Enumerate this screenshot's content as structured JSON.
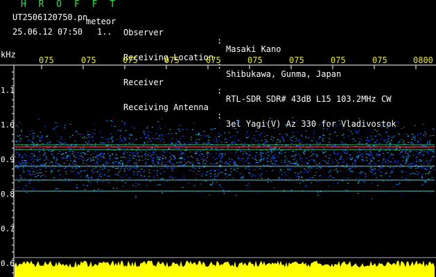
{
  "app": {
    "title": "H R O F F T"
  },
  "file": {
    "name": "UT2506120750.pn",
    "meteor_label": "meteor",
    "datetime": "25.06.12 07:50",
    "page": "1.."
  },
  "meta": [
    {
      "key": "Observer",
      "value": "Masaki Kano"
    },
    {
      "key": "Receiving Location",
      "value": "Shibukawa, Gunma, Japan"
    },
    {
      "key": "Receiver",
      "value": "RTL-SDR SDR# 43dB L15 103.2MHz CW"
    },
    {
      "key": "Receiving Antenna",
      "value": "3el Yagi(V) Az 330 for Vladivostok"
    }
  ],
  "axis": {
    "y_unit": "kHz",
    "y_ticks": [
      "1.1",
      "1.0",
      "0.9",
      "0.8",
      "0.7",
      "0.6"
    ],
    "x_ticks": [
      "075",
      "075",
      "075",
      "075",
      "075",
      "075",
      "075",
      "075",
      "075",
      "0800"
    ]
  },
  "colors": {
    "text": "#ffffff",
    "title": "#37e04a",
    "time_ticks": "#e8e84a",
    "noise": "#1e40ff",
    "signal": "#ff3030",
    "baseline": "#ffff00"
  }
}
